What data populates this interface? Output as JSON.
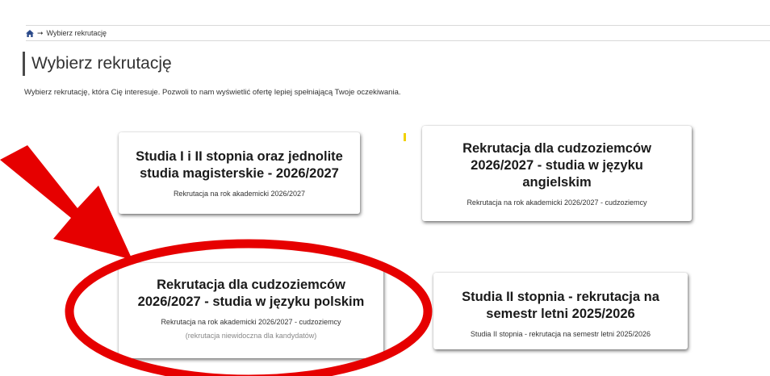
{
  "breadcrumb": {
    "current": "Wybierz rekrutację"
  },
  "page": {
    "title": "Wybierz rekrutację",
    "intro": "Wybierz rekrutację, która Cię interesuje. Pozwoli to nam wyświetlić ofertę lepiej spełniającą Twoje oczekiwania."
  },
  "cards": [
    {
      "title_line1": "Studia I i II stopnia oraz jednolite",
      "title_line2": "studia magisterskie - 2026/2027",
      "subtitle": "Rekrutacja na rok akademicki 2026/2027"
    },
    {
      "title_line1": "Rekrutacja dla cudzoziemców",
      "title_line2": "2026/2027 - studia w języku",
      "title_line3": "angielskim",
      "subtitle": "Rekrutacja na rok akademicki 2026/2027 - cudzoziemcy"
    },
    {
      "title_line1": "Rekrutacja dla cudzoziemców",
      "title_line2": "2026/2027 - studia w języku polskim",
      "subtitle": "Rekrutacja na rok akademicki 2026/2027 - cudzoziemcy",
      "note": "(rekrutacja niewidoczna dla kandydatów)"
    },
    {
      "title_line1": "Studia II stopnia - rekrutacja na",
      "title_line2": "semestr letni 2025/2026",
      "subtitle": "Studia II stopnia - rekrutacja na semestr letni 2025/2026"
    }
  ],
  "icons": {
    "home": "home-icon",
    "separator": "arrow-right-icon"
  },
  "colors": {
    "annotation": "#e60000",
    "text": "#222222"
  }
}
